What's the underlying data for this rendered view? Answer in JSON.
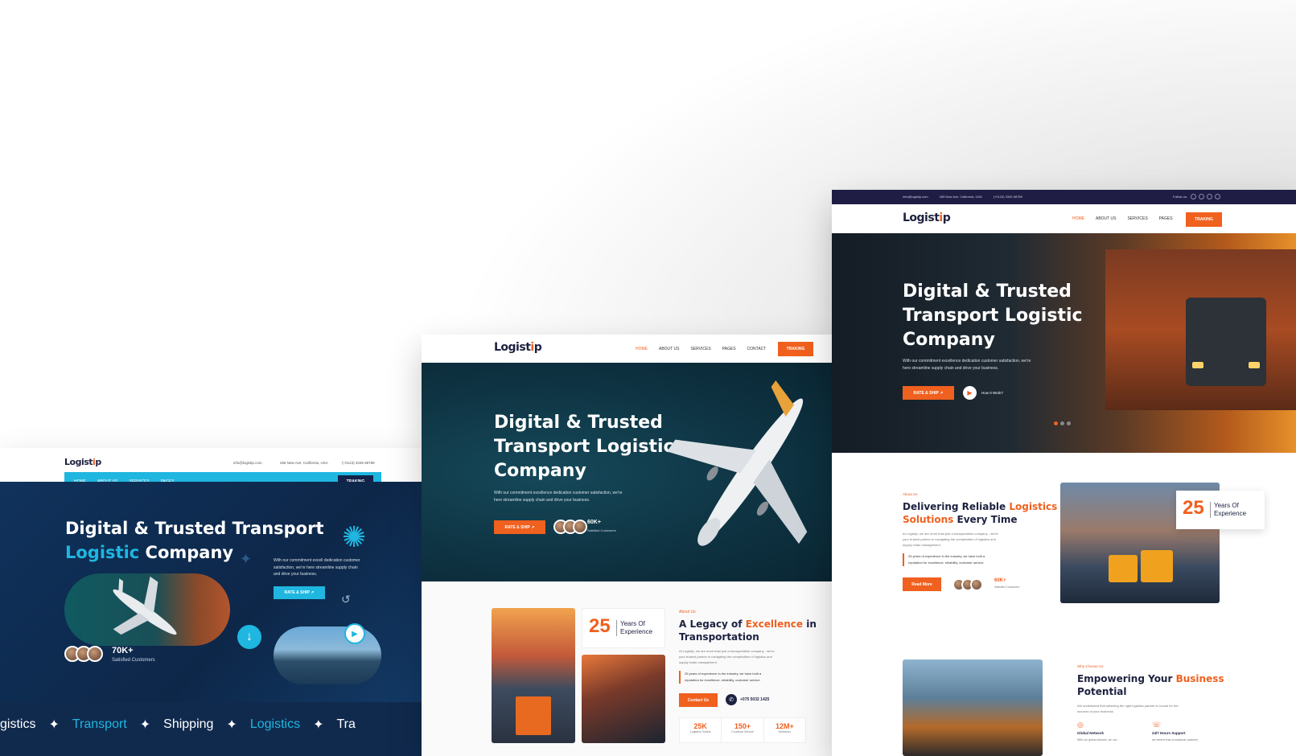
{
  "brand": {
    "name_a": "Logist",
    "name_b": "i",
    "name_c": "p"
  },
  "hero": {
    "title_a": "Digital & Trusted",
    "title_b": "Transport Logistic",
    "title_c": "Company",
    "desc1": "With our commitment excellence dedication customer satisfaction, we're",
    "desc2": "here streamline supply chain and drive your business."
  },
  "m1": {
    "email": "info@logistip.com",
    "address": "265 New Ave, California, USA",
    "phone": "(+0123) 3345 98789",
    "nav": [
      "HOME",
      "ABOUT US",
      "SERVICES",
      "PAGES"
    ],
    "cta": "TRAKING",
    "title_a": "Digital & Trusted Transport",
    "title_b1": "Logistic",
    "title_b2": "Company",
    "desc1": "With our commitment excell dedication customer",
    "desc2": "satisfaction, we're here streamline supply chain",
    "desc3": "and drive your business.",
    "btn": "RATE & SHIP",
    "stat": "70K+",
    "stat_label": "Satisfied Customers",
    "marquee": [
      "gistics",
      "Transport",
      "Shipping",
      "Logistics",
      "Tra"
    ]
  },
  "m2": {
    "nav": [
      "HOME",
      "ABOUT US",
      "SERVICES",
      "PAGES",
      "CONTACT"
    ],
    "cta": "TRAKING",
    "btn": "RATE & SHIP",
    "stat": "60K+",
    "stat_label": "Satisfied Customers",
    "years": "25",
    "years_a": "Years Of",
    "years_b": "Experience",
    "about": "About Us",
    "h_a": "A Legacy of",
    "h_b": "Excellence",
    "h_c": "in",
    "h_d": "Transportation",
    "p1": "At Logistip, we are more than just a transportation company - we're",
    "p2": "your trusted partner in navigating the complexities of logistics and",
    "p3": "supply chain management.",
    "q1": "25 years of experience in the industry, we have built a",
    "q2": "reputation for excellence, reliability, customer service.",
    "contact": "Contact Us",
    "phone": "+075 5032 1425",
    "stats": [
      {
        "n": "25K",
        "l": "Logistics Outlets"
      },
      {
        "n": "150+",
        "l": "Countries Service"
      },
      {
        "n": "12M+",
        "l": "Deliveries"
      }
    ]
  },
  "m3": {
    "top_email": "info@logistip.com",
    "top_address": "265 New Ave, California, USA",
    "top_phone": "(+0123) 3345 98789",
    "follow": "Follow us:",
    "nav": [
      "HOME",
      "ABOUT US",
      "SERVICES",
      "PAGES"
    ],
    "cta": "TRAKING",
    "btn": "RATE & SHIP",
    "how": "How It Work?",
    "about": "About Us",
    "h_a": "Delivering Reliable",
    "h_b": "Logistics",
    "h_c": "Solutions",
    "h_d": "Every Time",
    "p1": "At Logistip, we are more than just a transportation company - we're",
    "p2": "your trusted partner in navigating the complexities of logistics and",
    "p3": "supply chain management.",
    "q1": "25 years of experience in the industry, we have built a",
    "q2": "reputation for excellence, reliability, customer service.",
    "read": "Read More",
    "stat": "60K+",
    "stat_label": "Satisfied Customers",
    "years": "25",
    "years_a": "Years Of",
    "years_b": "Experience",
    "why": "Why Choose Us",
    "h2_a": "Empowering Your",
    "h2_b": "Business",
    "h2_c": "Potential",
    "w1": "We understand that selecting the right logistics partner is crucial for the",
    "w2": "success of your business.",
    "f1": "Global Network",
    "f1d": "With our global network, we can",
    "f2": "24/7 Hours Support",
    "f2d": "we believe that exceptional customer"
  },
  "colors": {
    "orange": "#f0601e",
    "navy": "#1d2140",
    "cyan": "#1fb6e0",
    "teal": "#0f3d4d"
  }
}
